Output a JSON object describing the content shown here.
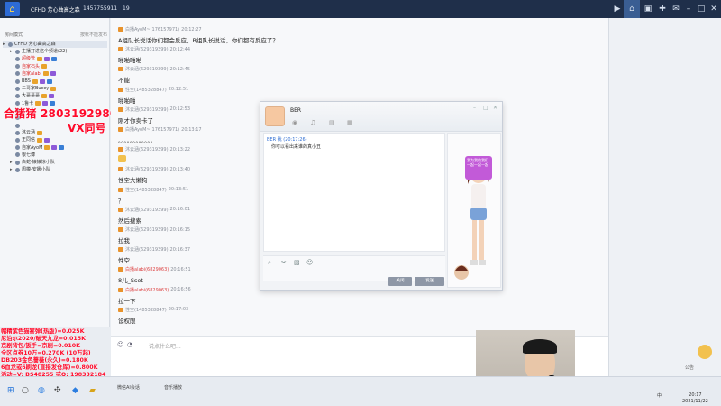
{
  "topbar": {
    "title": "CFHD 芳心曲高之森",
    "channel_id": "1457755911",
    "user_count": "19"
  },
  "left": {
    "header_left": "房间模式",
    "header_right": "按帐不能发布",
    "tree": [
      {
        "label": "CFHD 芳心曲高之森",
        "style": "root"
      },
      {
        "label": "主播打进这个频道(22)",
        "style": "normal"
      },
      {
        "label": "超级管",
        "style": "red"
      },
      {
        "label": "自家石头",
        "style": "red"
      },
      {
        "label": "自家alabi",
        "style": "red"
      },
      {
        "label": "BBS",
        "style": "normal"
      },
      {
        "label": "二哥家Bucey",
        "style": "normal"
      },
      {
        "label": "大哥哥哥",
        "style": "normal"
      },
      {
        "label": "1鲁卡",
        "style": "normal"
      },
      {
        "label": "",
        "style": "normal"
      },
      {
        "label": "",
        "style": "normal"
      },
      {
        "label": "",
        "style": "normal"
      },
      {
        "label": "沐云涵",
        "style": "normal"
      },
      {
        "label": "王同信",
        "style": "normal"
      },
      {
        "label": "自家AyoM",
        "style": "normal"
      },
      {
        "label": "很七博",
        "style": "normal"
      },
      {
        "label": "白蛇-娘娘惊小队",
        "style": "normal"
      },
      {
        "label": "周樽-安娜小队",
        "style": "normal"
      }
    ]
  },
  "ads": {
    "top": "合猪猪 2803192980",
    "vx": "VX同号",
    "list": [
      "帽精紫色猫雾弹(热版)=0.025K",
      "尼泊尔2020/破天九龙=0.015K",
      "京剧背包/扳手=京剧=0.010K",
      "全区点券10万=0.270K (10万起)",
      "DB203金色薔薇(永久)=0.180K",
      "6血龙或6刷龙(直接发仓库)=0.800K",
      "活动=V: BS48255    或Q: 198332184"
    ]
  },
  "chat": {
    "messages": [
      {
        "name": "白播AyoM~(176157971)",
        "time": "20:12:27",
        "text": "A组队长说话你们都会反应，B组队长说话，你们都有反应了？",
        "red": false
      },
      {
        "name": "沐云涵(629319399)",
        "time": "20:12:44",
        "text": "啪啪啪啪",
        "red": false
      },
      {
        "name": "沐云涵(629319399)",
        "time": "20:12:45",
        "text": "不能",
        "red": false
      },
      {
        "name": "性空(1485328847)",
        "time": "20:12:51",
        "text": "啪啪啪",
        "red": false
      },
      {
        "name": "沐云涵(629319399)",
        "time": "20:12:53",
        "text": "刚才你卖卡了",
        "red": false
      },
      {
        "name": "白播AyoM~(176157971)",
        "time": "20:13:17",
        "text": "。。。。。。。。。。。。",
        "red": false
      },
      {
        "name": "沐云涵(629319399)",
        "time": "20:13:22",
        "text": "",
        "red": false
      },
      {
        "name": "沐云涵(629319399)",
        "time": "20:13:40",
        "text": "性空大懒狗",
        "red": false
      },
      {
        "name": "性空(1485328847)",
        "time": "20:13:51",
        "text": "？",
        "red": false
      },
      {
        "name": "沐云涵(629319399)",
        "time": "20:16:01",
        "text": "然后搜索",
        "red": false
      },
      {
        "name": "沐云涵(629319399)",
        "time": "20:16:15",
        "text": "拉我",
        "red": false
      },
      {
        "name": "沐云涵(629319399)",
        "time": "20:16:37",
        "text": "性空",
        "red": false
      },
      {
        "name": "白播alabi(6829063)",
        "time": "20:16:51",
        "text": "8儿_Sset",
        "red": true
      },
      {
        "name": "白播alabi(6829063)",
        "time": "20:16:56",
        "text": "拉一下",
        "red": true
      },
      {
        "name": "性空(1485328847)",
        "time": "20:17:03",
        "text": "设权限",
        "red": false
      }
    ],
    "input_placeholder": "说点什么吧..."
  },
  "popup": {
    "contact_name": "BER",
    "history_name": "BER 我 (20:17:26)",
    "history_text": "你可以看出来谁的真小丑",
    "speech_text": "我为我的我们一起一起一起",
    "btn_close": "关闭",
    "btn_send": "发送"
  },
  "right": {
    "buttons": [
      "公告",
      "",
      "",
      ""
    ]
  },
  "taskbar": {
    "labels": [
      "微信AI会话",
      "音乐播放",
      "爱看"
    ],
    "clock_time": "20:17",
    "clock_date": "2021/11/22",
    "lang": "中"
  },
  "colors": {
    "topbar": "#1f2f4a",
    "ad_red": "#ff0a2a",
    "accent": "#2d6bd6"
  }
}
